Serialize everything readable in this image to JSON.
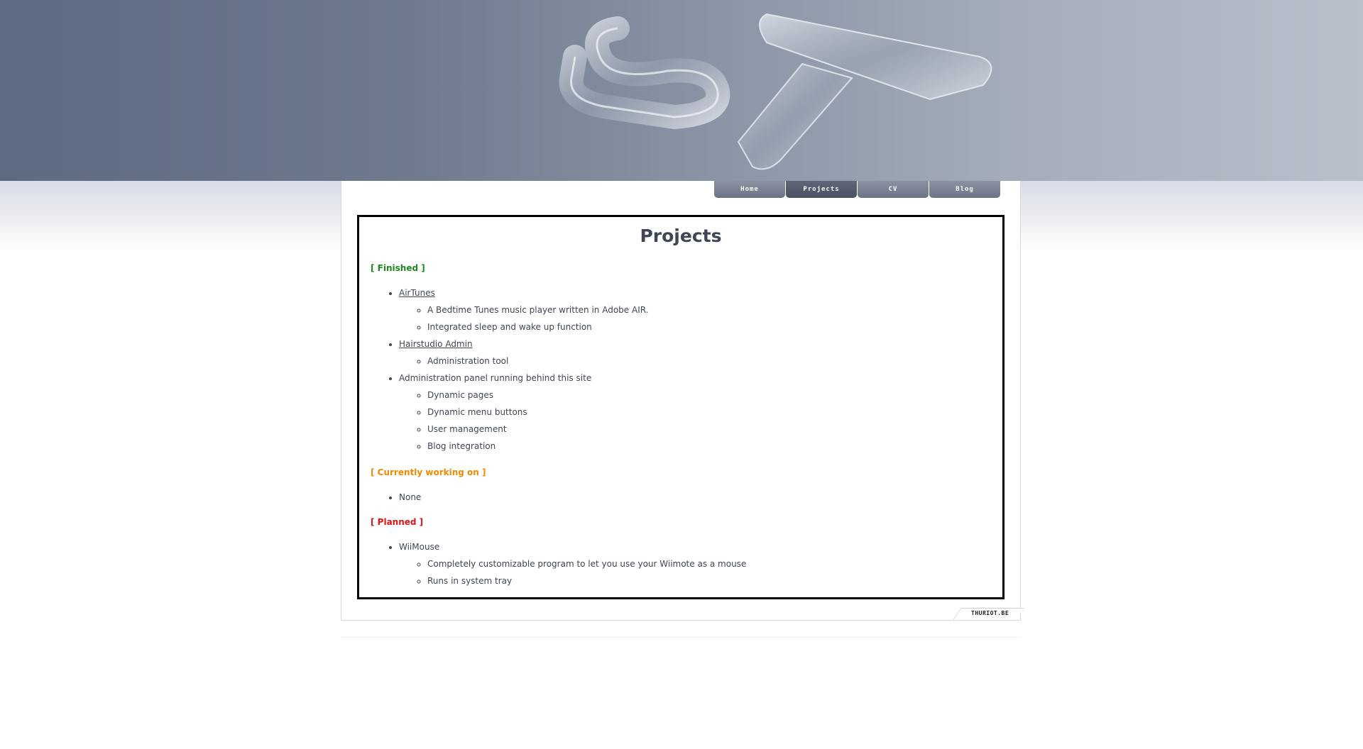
{
  "nav": {
    "tabs": [
      {
        "label": "Home"
      },
      {
        "label": "Projects"
      },
      {
        "label": "CV"
      },
      {
        "label": "Blog"
      }
    ]
  },
  "page": {
    "title": "Projects"
  },
  "sections": {
    "finished": {
      "heading": "[ Finished ]",
      "items": [
        {
          "label": "AirTunes",
          "link": true,
          "sub": [
            "A Bedtime Tunes music player written in Adobe AIR.",
            "Integrated sleep and wake up function"
          ]
        },
        {
          "label": "Hairstudio Admin",
          "link": true,
          "sub": [
            "Administration tool"
          ]
        },
        {
          "label": "Administration panel running behind this site",
          "link": false,
          "sub": [
            "Dynamic pages",
            "Dynamic menu buttons",
            "User management",
            "Blog integration"
          ]
        }
      ]
    },
    "current": {
      "heading": "[ Currently working on ]",
      "items": [
        {
          "label": "None"
        }
      ]
    },
    "planned": {
      "heading": "[ Planned ]",
      "items": [
        {
          "label": "WiiMouse",
          "sub": [
            "Completely customizable program to let you use your Wiimote as a mouse",
            "Runs in system tray"
          ]
        }
      ]
    }
  },
  "footer": {
    "badge": "THURIOT.BE"
  },
  "colors": {
    "finished": "#1c8a1c",
    "current": "#f08a00",
    "planned": "#e01414",
    "text": "#3f4656"
  },
  "icons": {
    "logo": "glass-st-logo-icon"
  }
}
